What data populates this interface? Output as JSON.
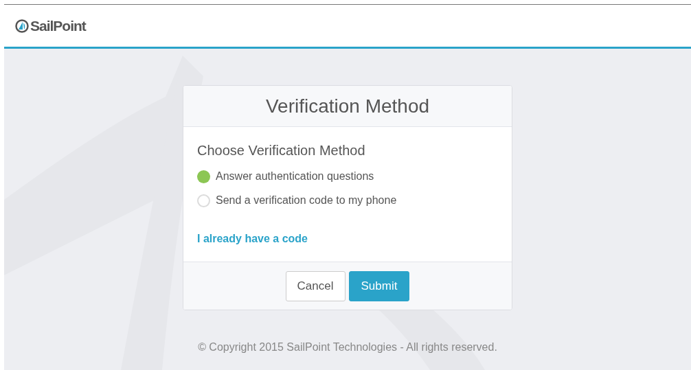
{
  "header": {
    "logo_text": "SailPoint"
  },
  "card": {
    "title": "Verification Method",
    "heading": "Choose Verification Method",
    "options": [
      {
        "label": "Answer authentication questions",
        "selected": true
      },
      {
        "label": "Send a verification code to my phone",
        "selected": false
      }
    ],
    "link": "I already have a code",
    "buttons": [
      {
        "label": "Cancel",
        "kind": "secondary"
      },
      {
        "label": "Submit",
        "kind": "primary"
      }
    ]
  },
  "footer": "© Copyright 2015 SailPoint Technologies - All rights reserved."
}
